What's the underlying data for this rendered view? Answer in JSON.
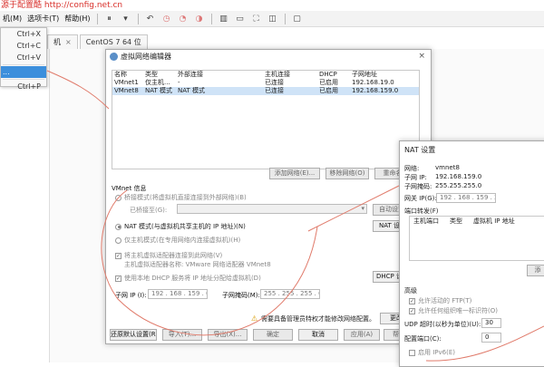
{
  "watermark": "源于配置酷  http://config.net.cn",
  "menubar": {
    "items": [
      "机(M)",
      "选项卡(T)",
      "帮助(H)"
    ],
    "icons": [
      "pause-icon",
      "dropdown-arrow-icon",
      "back-icon",
      "snapshot-icon",
      "revert-icon",
      "snapshot-manager-icon",
      "sidebar-icon",
      "console-icon",
      "fullscreen-icon",
      "unity-icon",
      "terminal-icon"
    ]
  },
  "dropdown": {
    "items": [
      {
        "label": "Ctrl+X",
        "selected": false
      },
      {
        "label": "Ctrl+C",
        "selected": false
      },
      {
        "label": "Ctrl+V",
        "selected": false
      },
      {
        "label": "...",
        "selected": true
      },
      {
        "label": "Ctrl+P",
        "selected": false
      }
    ]
  },
  "tabs": [
    {
      "label": "机"
    },
    {
      "label": "CentOS 7 64 位"
    }
  ],
  "vne": {
    "title": "虚拟网络编辑器",
    "columns": [
      "名称",
      "类型",
      "外部连接",
      "主机连接",
      "DHCP",
      "子网地址"
    ],
    "rows": [
      {
        "name": "VMnet1",
        "type": "仅主机...",
        "ext": "-",
        "host": "已连接",
        "dhcp": "已启用",
        "subnet": "192.168.19.0"
      },
      {
        "name": "VMnet8",
        "type": "NAT 模式",
        "ext": "NAT 模式",
        "host": "已连接",
        "dhcp": "已启用",
        "subnet": "192.168.159.0"
      }
    ],
    "buttons": {
      "add": "添加网络(E)...",
      "remove": "移除网络(O)",
      "rename": "重命名"
    },
    "info_title": "VMnet 信息",
    "bridge_label": "桥接模式(将虚拟机直接连接到外部网络)(B)",
    "bridged_to_label": "已桥接至(G):",
    "auto_settings": "自动设置",
    "nat_label": "NAT 模式(与虚拟机共享主机的 IP 地址)(N)",
    "nat_settings_btn": "NAT 设置",
    "hostonly_label": "仅主机模式(在专用网络内连接虚拟机)(H)",
    "connect_adapter_label": "将主机虚拟适配器连接到此网络(V)",
    "adapter_name": "主机虚拟适配器名称: VMware 网络适配器 VMnet8",
    "dhcp_label": "使用本地 DHCP 服务将 IP 地址分配给虚拟机(D)",
    "dhcp_settings_btn": "DHCP 设置",
    "subnet_ip_label": "子网 IP (I):",
    "subnet_ip": "192 . 168 . 159 . 0",
    "subnet_mask_label": "子网掩码(M):",
    "subnet_mask": "255 . 255 . 255 . 0",
    "admin_warning": "需要具备管理员特权才能修改网络配置。",
    "admin_btn": "更改",
    "footer": {
      "restore": "还原默认设置(R)",
      "import": "导入(T)...",
      "export": "导出(X)...",
      "ok": "确定",
      "cancel": "取消",
      "apply": "应用(A)",
      "help": "帮助"
    }
  },
  "nat": {
    "title": "NAT 设置",
    "network_label": "网络:",
    "network": "vmnet8",
    "subnet_ip_label": "子网 IP:",
    "subnet_ip": "192.168.159.0",
    "subnet_mask_label": "子网掩码:",
    "subnet_mask": "255.255.255.0",
    "gateway_label": "网关 IP(G):",
    "gateway": "192 . 168 . 159 . 2",
    "port_forward_label": "端口转发(F)",
    "pf_columns": [
      "主机端口",
      "类型",
      "虚拟机 IP 地址"
    ],
    "add_btn": "添",
    "advanced_label": "高级",
    "ftp_label": "允许活动的 FTP(T)",
    "oui_label": "允许任何组织唯一标识符(O)",
    "udp_label": "UDP 超时(以秒为单位)(U):",
    "udp_value": "30",
    "config_port_label": "配置端口(C):",
    "config_port_value": "0",
    "ipv6_label": "启用 IPv6(E)"
  }
}
